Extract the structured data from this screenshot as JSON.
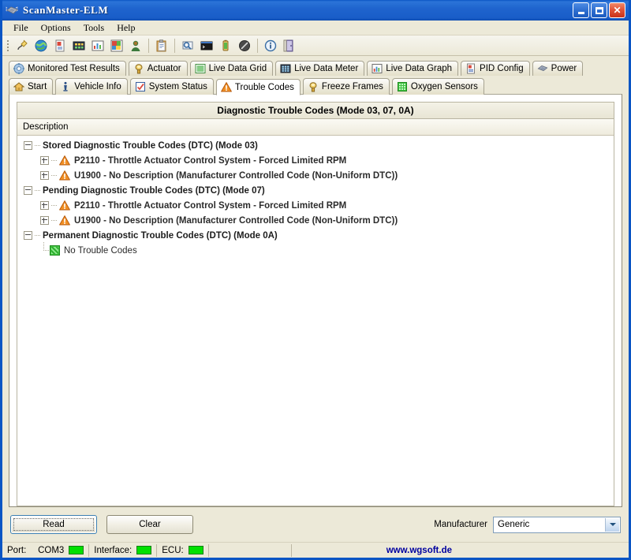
{
  "window": {
    "title": "ScanMaster-ELM",
    "title_icon": "chip-icon",
    "controls": {
      "minimize": "minimize-button",
      "maximize": "maximize-button",
      "close": "close-button"
    }
  },
  "menu": {
    "items": [
      {
        "label": "File"
      },
      {
        "label": "Options"
      },
      {
        "label": "Tools"
      },
      {
        "label": "Help"
      }
    ]
  },
  "toolbar": {
    "buttons": [
      {
        "icon": "connect-plug-icon"
      },
      {
        "icon": "globe-icon"
      },
      {
        "icon": "report-icon"
      },
      {
        "icon": "grid-icon"
      },
      {
        "icon": "bar-chart-icon"
      },
      {
        "icon": "image-icon"
      },
      {
        "icon": "user-icon"
      },
      {
        "icon": "clipboard-icon"
      },
      {
        "icon": "terminal-search-icon"
      },
      {
        "icon": "console-icon"
      },
      {
        "icon": "battery-icon"
      },
      {
        "icon": "disable-icon"
      },
      {
        "icon": "info-icon"
      },
      {
        "icon": "exit-door-icon"
      }
    ]
  },
  "tabs": {
    "row1": [
      {
        "label": "Monitored Test Results",
        "icon": "gear-icon",
        "active": false
      },
      {
        "label": "Actuator",
        "icon": "actuator-icon",
        "active": false
      },
      {
        "label": "Live Data Grid",
        "icon": "list-icon",
        "active": false
      },
      {
        "label": "Live Data Meter",
        "icon": "meter-grid-icon",
        "active": false
      },
      {
        "label": "Live Data Graph",
        "icon": "chart-icon",
        "active": false
      },
      {
        "label": "PID Config",
        "icon": "pid-config-icon",
        "active": false
      },
      {
        "label": "Power",
        "icon": "power-chip-icon",
        "active": false
      }
    ],
    "row2": [
      {
        "label": "Start",
        "icon": "home-icon",
        "active": false
      },
      {
        "label": "Vehicle Info",
        "icon": "info-i-icon",
        "active": false
      },
      {
        "label": "System Status",
        "icon": "checklist-icon",
        "active": false
      },
      {
        "label": "Trouble Codes",
        "icon": "warning-triangle-icon",
        "active": true
      },
      {
        "label": "Freeze Frames",
        "icon": "freeze-icon",
        "active": false
      },
      {
        "label": "Oxygen Sensors",
        "icon": "oxygen-icon",
        "active": false
      }
    ]
  },
  "panel": {
    "title": "Diagnostic Trouble Codes (Mode 03, 07, 0A)",
    "column_header": "Description",
    "rows": [
      {
        "level": 0,
        "expander": "minus",
        "icon": "none",
        "text": "Stored Diagnostic Trouble Codes (DTC) (Mode 03)",
        "style": "group"
      },
      {
        "level": 1,
        "expander": "plus",
        "icon": "warning-triangle-icon",
        "text": "P2110 - Throttle Actuator Control System - Forced Limited RPM",
        "style": "leaf"
      },
      {
        "level": 1,
        "expander": "plus",
        "icon": "warning-triangle-icon",
        "text": "U1900 - No Description (Manufacturer Controlled Code (Non-Uniform DTC))",
        "style": "leaf"
      },
      {
        "level": 0,
        "expander": "minus",
        "icon": "none",
        "text": "Pending Diagnostic Trouble Codes (DTC) (Mode 07)",
        "style": "group"
      },
      {
        "level": 1,
        "expander": "plus",
        "icon": "warning-triangle-icon",
        "text": "P2110 - Throttle Actuator Control System - Forced Limited RPM",
        "style": "leaf"
      },
      {
        "level": 1,
        "expander": "plus",
        "icon": "warning-triangle-icon",
        "text": "U1900 - No Description (Manufacturer Controlled Code (Non-Uniform DTC))",
        "style": "leaf"
      },
      {
        "level": 0,
        "expander": "minus",
        "icon": "none",
        "text": "Permanent Diagnostic Trouble Codes (DTC) (Mode 0A)",
        "style": "group"
      },
      {
        "level": 1,
        "expander": "none",
        "icon": "green-ok-icon",
        "text": "No Trouble Codes",
        "style": "plain"
      }
    ]
  },
  "actions": {
    "read_label": "Read",
    "clear_label": "Clear",
    "manufacturer_label": "Manufacturer",
    "manufacturer_value": "Generic"
  },
  "status": {
    "port_label": "Port:",
    "port_value": "COM3",
    "port_led": "#00e000",
    "interface_label": "Interface:",
    "interface_led": "#00e000",
    "ecu_label": "ECU:",
    "ecu_led": "#00e000",
    "url": "www.wgsoft.de"
  },
  "colors": {
    "title_bar": "#1f64ce",
    "window_face": "#ece9d8",
    "accent_orange": "#f0a82a",
    "link_blue": "#0000a0"
  }
}
